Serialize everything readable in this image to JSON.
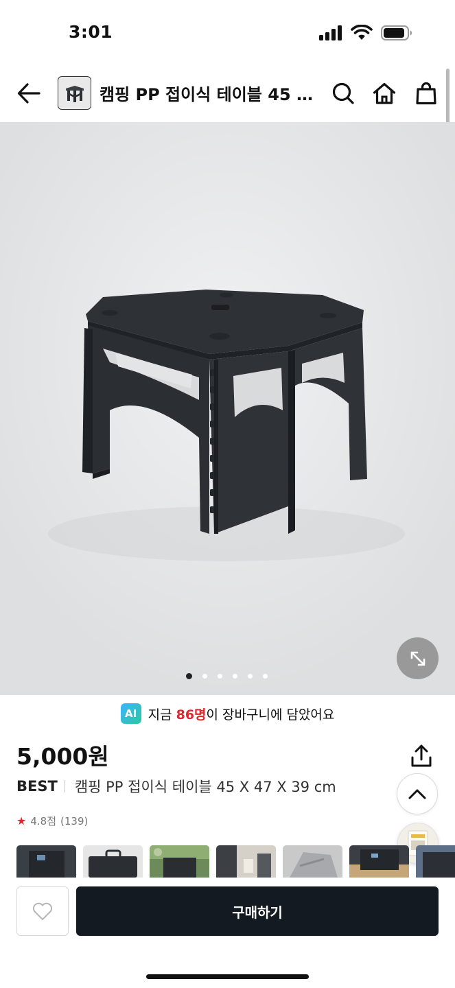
{
  "status": {
    "time": "3:01"
  },
  "header": {
    "title": "캠핑 PP 접이식 테이블 45 X 47 X 39 cm",
    "icons": [
      "back-arrow-icon",
      "search-icon",
      "home-icon",
      "shopping-bag-icon"
    ]
  },
  "gallery": {
    "image_count": 6,
    "active_index": 0
  },
  "ai_banner": {
    "badge": "AI",
    "prefix": "지금 ",
    "count": "86명",
    "suffix": "이 장바구니에 담았어요"
  },
  "product": {
    "price": "5,000원",
    "brand": "BEST",
    "name": "캠핑 PP 접이식 테이블 45 X 47 X 39 cm",
    "rating": "4.8점",
    "review_count": "(139)"
  },
  "bottom": {
    "buy_label": "구매하기"
  },
  "colors": {
    "accent_red": "#e0262f",
    "buy_button": "#141a22"
  }
}
